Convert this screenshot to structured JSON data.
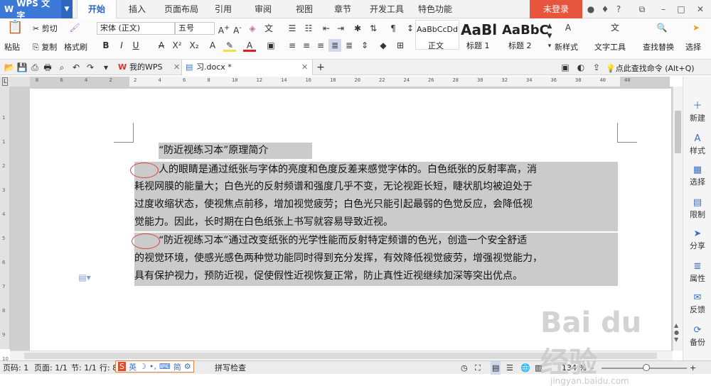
{
  "app": {
    "name": "WPS 文字"
  },
  "menu_tabs": [
    "开始",
    "插入",
    "页面布局",
    "引用",
    "审阅",
    "视图",
    "章节",
    "开发工具",
    "特色功能"
  ],
  "active_tab": "开始",
  "login": "未登录",
  "ribbon": {
    "paste": "粘贴",
    "cut": "剪切",
    "copy": "复制",
    "format_painter": "格式刷",
    "font_name": "宋体 (正文)",
    "font_size": "五号",
    "styles": [
      {
        "preview": "AaBbCcDd",
        "name": "正文"
      },
      {
        "preview": "AaBl",
        "name": "标题 1"
      },
      {
        "preview": "AaBbC",
        "name": "标题 2"
      }
    ],
    "new_style": "新样式",
    "text_tools": "文字工具",
    "find_replace": "查找替换",
    "select": "选择"
  },
  "doc_tabs": [
    {
      "label": "我的WPS"
    },
    {
      "label": "习.docx *"
    }
  ],
  "search_cmd": "点此查找命令 (Alt+Q)",
  "ruler": {
    "h": [
      "8",
      "6",
      "4",
      "2",
      "2",
      "4",
      "6",
      "8",
      "10",
      "12",
      "14",
      "16",
      "18",
      "20",
      "22",
      "24",
      "26",
      "28",
      "30",
      "32",
      "34",
      "36",
      "38",
      "40",
      "40"
    ],
    "v": [
      "1",
      "1",
      "2",
      "3",
      "4",
      "5",
      "6",
      "7",
      "8",
      "9",
      "10"
    ]
  },
  "document": {
    "lines": [
      "“防近视练习本”原理简介",
      "人的眼睛是通过纸张与字体的亮度和色度反差来感觉字体的。白色纸张的反射率高，消",
      "耗视网膜的能量大；白色光的反射频谱和强度几乎不变，无论视距长短，睫状肌均被迫处于",
      "过度收缩状态，使视焦点前移，增加视觉疲劳；白色光只能引起最弱的色觉反应，会降低视",
      "觉能力。因此，长时期在白色纸张上书写就容易导致近视。",
      "“防近视练习本”通过改变纸张的光学性能而反射特定频谱的色光，创造一个安全舒适",
      "的视觉环境，使感光感色两种觉功能同时得到充分发挥，有效降低视觉疲劳，增强视觉能力，",
      "具有保护视力，预防近视，促使假性近视恢复正常，防止真性近视继续加深等突出优点。"
    ]
  },
  "right_panel": [
    "新建",
    "样式",
    "选择",
    "限制",
    "分享",
    "属性",
    "反馈",
    "备份"
  ],
  "status": {
    "page_code": "页码: 1",
    "pages": "页面: 1/1",
    "section": "节: 1/1",
    "row": "行: 8",
    "spell": "拼写检查",
    "zoom": "134 %"
  },
  "ime": {
    "lang": "英",
    "simp": "简"
  },
  "watermark": "Bai du 经验",
  "watermark_url": "jingyan.baidu.com"
}
